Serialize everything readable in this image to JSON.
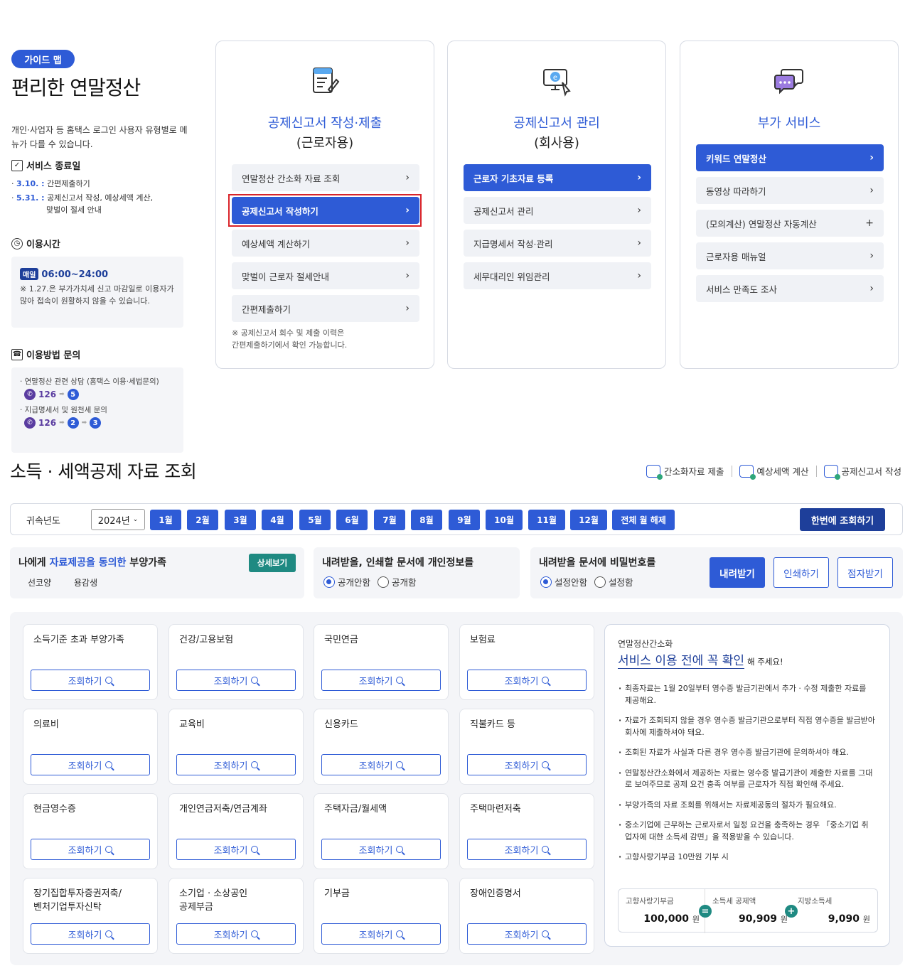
{
  "guide": {
    "badge": "가이드 맵",
    "title": "편리한 연말정산",
    "desc": "개인·사업자 등 홈택스 로그인 사용자 유형별로 메뉴가 다를 수 있습니다.",
    "service_end": {
      "heading": "서비스 종료일",
      "items": [
        {
          "date": "3.10. :",
          "text": "간편제출하기"
        },
        {
          "date": "5.31. :",
          "text": "공제신고서 작성, 예상세액 계산,",
          "text2": "맞벌이 절세 안내"
        }
      ]
    },
    "hours": {
      "heading": "이용시간",
      "badge": "매일",
      "time": "06:00~24:00",
      "note": "※ 1.27.은 부가가치세 신고 마감일로 이용자가 많아 접속이 원활하지 않을 수 있습니다."
    },
    "inquiry": {
      "heading": "이용방법 문의",
      "items": [
        {
          "text": "· 연말정산 관련 상담 (홈택스 이용·세법문의)",
          "phone": "126",
          "nums": [
            "5"
          ]
        },
        {
          "text": "· 지급명세서 및 원천세 문의",
          "phone": "126",
          "nums": [
            "2",
            "3"
          ]
        }
      ]
    }
  },
  "cards": [
    {
      "title": "공제신고서 작성·제출",
      "subtitle": "(근로자용)",
      "icon": "form-write-icon",
      "items": [
        {
          "label": "연말정산 간소화 자료 조회",
          "active": false
        },
        {
          "label": "공제신고서 작성하기",
          "active": true
        },
        {
          "label": "예상세액 계산하기",
          "active": false
        },
        {
          "label": "맞벌이 근로자 절세안내",
          "active": false
        },
        {
          "label": "간편제출하기",
          "active": false
        }
      ],
      "note": "※ 공제신고서 회수 및 제출 이력은\n   간편제출하기에서 확인 가능합니다."
    },
    {
      "title": "공제신고서 관리",
      "subtitle": "(회사용)",
      "icon": "e-computer-icon",
      "items": [
        {
          "label": "근로자 기초자료 등록",
          "active": true
        },
        {
          "label": "공제신고서 관리",
          "active": false
        },
        {
          "label": "지급명세서 작성·관리",
          "active": false
        },
        {
          "label": "세무대리인 위임관리",
          "active": false
        }
      ]
    },
    {
      "title": "부가 서비스",
      "subtitle": "",
      "icon": "chat-bubbles-icon",
      "items": [
        {
          "label": "키워드 연말정산",
          "active": true,
          "glyph": "›"
        },
        {
          "label": "동영상 따라하기",
          "active": false,
          "glyph": "›"
        },
        {
          "label": "(모의계산) 연말정산 자동계산",
          "active": false,
          "glyph": "+"
        },
        {
          "label": "근로자용 매뉴얼",
          "active": false,
          "glyph": "›"
        },
        {
          "label": "서비스 만족도 조사",
          "active": false,
          "glyph": "›"
        }
      ]
    }
  ],
  "section2": {
    "title": "소득 · 세액공제 자료 조회",
    "quick_links": [
      "간소화자료 제출",
      "예상세액 계산",
      "공제신고서 작성"
    ],
    "year_label": "귀속년도",
    "year_value": "2024년",
    "months": [
      "1월",
      "2월",
      "3월",
      "4월",
      "5월",
      "6월",
      "7월",
      "8월",
      "9월",
      "10월",
      "11월",
      "12월"
    ],
    "clear_all": "전체 월 해제",
    "query_all": "한번에 조회하기",
    "dependents": {
      "title_pre": "나에게 ",
      "title_em": "자료제공을 동의한",
      "title_post": " 부양가족",
      "detail": "상세보기",
      "names": [
        "선코양",
        "용감생"
      ]
    },
    "privacy": {
      "title": "내려받을, 인쇄할 문서에 개인정보를",
      "options": [
        "공개안함",
        "공개함"
      ],
      "selected": 0
    },
    "password": {
      "title": "내려받을 문서에 비밀번호를",
      "options": [
        "설정안함",
        "설정함"
      ],
      "selected": 0
    },
    "actions": [
      "내려받기",
      "인쇄하기",
      "점자받기"
    ],
    "query_label": "조회하기",
    "tiles": [
      [
        "소득기준 초과 부양가족",
        "건강/고용보험",
        "국민연금",
        "보험료"
      ],
      [
        "의료비",
        "교육비",
        "신용카드",
        "직불카드 등"
      ],
      [
        "현금영수증",
        "개인연금저축/연금계좌",
        "주택자금/월세액",
        "주택마련저축"
      ],
      [
        "장기집합투자증권저축/\n벤처기업투자신탁",
        "소기업 · 소상공인\n공제부금",
        "기부금",
        "장애인증명서"
      ]
    ],
    "info": {
      "kicker": "연말정산간소화",
      "title": "서비스 이용 전에 꼭 확인",
      "title_suffix": "해 주세요!",
      "items": [
        "최종자료는 1월 20일부터 영수증 발급기관에서 추가 · 수정 제출한 자료를 제공해요.",
        "자료가 조회되지 않을 경우 영수증 발급기관으로부터 직접 영수증을 발급받아 회사에 제출하셔야 돼요.",
        "조회된 자료가 사실과 다른 경우 영수증 발급기관에 문의하셔야 해요.",
        "연말정산간소화에서 제공하는 자료는 영수증 발급기관이 제출한 자료를 그대로 보여주므로 공제 요건 충족 여부를 근로자가 직접 확인해 주세요.",
        "부양가족의 자료 조회를 위해서는 자료제공동의 절차가 필요해요.",
        "중소기업에 근무하는 근로자로서 일정 요건을 충족하는 경우 「중소기업 취업자에 대한 소득세 감면」을 적용받을 수 있습니다.",
        "고향사랑기부금 10만원 기부 시"
      ],
      "calc": {
        "labels": [
          "고향사랑기부금",
          "소득세 공제액",
          "지방소득세"
        ],
        "values": [
          "100,000",
          "90,909",
          "9,090"
        ],
        "unit": "원",
        "ops": [
          "=",
          "+"
        ]
      }
    }
  },
  "colors": {
    "primary": "#2e5bd6",
    "dark_primary": "#1e3f9a",
    "teal": "#1f8a82",
    "highlight": "#d9242a"
  }
}
